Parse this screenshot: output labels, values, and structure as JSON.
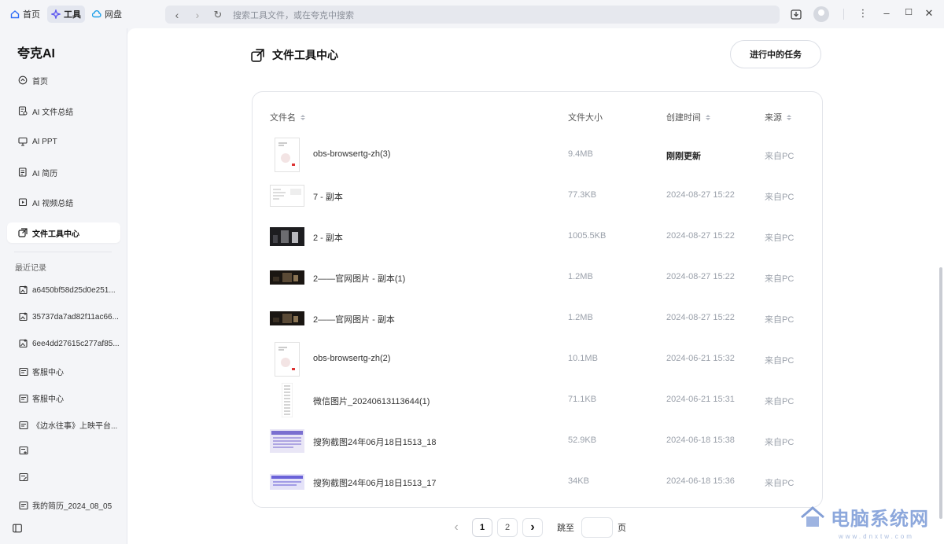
{
  "top": {
    "tabs": [
      {
        "label": "首页",
        "icon": "home-icon"
      },
      {
        "label": "工具",
        "icon": "sparkle-icon",
        "active": true
      },
      {
        "label": "网盘",
        "icon": "cloud-icon"
      }
    ],
    "search_placeholder": "搜索工具文件，或在夸克中搜索"
  },
  "sidebar": {
    "brand": "夸克AI",
    "items": [
      {
        "label": "首页",
        "icon": "home-icon"
      },
      {
        "label": "AI 文件总结",
        "icon": "doc-summary-icon"
      },
      {
        "label": "AI PPT",
        "icon": "presentation-icon"
      },
      {
        "label": "AI 简历",
        "icon": "resume-icon"
      },
      {
        "label": "AI 视频总结",
        "icon": "video-summary-icon"
      },
      {
        "label": "文件工具中心",
        "icon": "file-tools-icon",
        "active": true
      }
    ],
    "recent_title": "最近记录",
    "recent": [
      {
        "label": "a6450bf58d25d0e251...",
        "icon": "image-icon"
      },
      {
        "label": "35737da7ad82f11ac66...",
        "icon": "image-icon"
      },
      {
        "label": "6ee4dd27615c277af85...",
        "icon": "image-icon"
      },
      {
        "label": "客服中心",
        "icon": "doc-icon"
      },
      {
        "label": "客服中心",
        "icon": "doc-icon"
      },
      {
        "label": "《边水往事》上映平台...",
        "icon": "doc-icon"
      },
      {
        "label": "",
        "icon": "doc-add-icon"
      },
      {
        "label": "",
        "icon": "doc-edit-icon"
      },
      {
        "label": "我的简历_2024_08_05",
        "icon": "doc-icon"
      }
    ]
  },
  "main": {
    "title": "文件工具中心",
    "tasks_button": "进行中的任务",
    "columns": {
      "name": "文件名",
      "size": "文件大小",
      "time": "创建时间",
      "source": "来源"
    },
    "files": [
      {
        "name": "obs-browsertg-zh(3)",
        "size": "9.4MB",
        "time": "刚刚更新",
        "source": "来自PC",
        "thumb": "pdf"
      },
      {
        "name": "7 - 副本",
        "size": "77.3KB",
        "time": "2024-08-27 15:22",
        "source": "来自PC",
        "thumb": "page"
      },
      {
        "name": "2 - 副本",
        "size": "1005.5KB",
        "time": "2024-08-27 15:22",
        "source": "来自PC",
        "thumb": "dark"
      },
      {
        "name": "2——官网图片 - 副本(1)",
        "size": "1.2MB",
        "time": "2024-08-27 15:22",
        "source": "来自PC",
        "thumb": "darkwide"
      },
      {
        "name": "2——官网图片 - 副本",
        "size": "1.2MB",
        "time": "2024-08-27 15:22",
        "source": "来自PC",
        "thumb": "darkwide"
      },
      {
        "name": "obs-browsertg-zh(2)",
        "size": "10.1MB",
        "time": "2024-06-21 15:32",
        "source": "来自PC",
        "thumb": "pdf"
      },
      {
        "name": "微信图片_20240613113644(1)",
        "size": "71.1KB",
        "time": "2024-06-21 15:31",
        "source": "来自PC",
        "thumb": "tall"
      },
      {
        "name": "搜狗截图24年06月18日1513_18",
        "size": "52.9KB",
        "time": "2024-06-18 15:38",
        "source": "来自PC",
        "thumb": "screenshot"
      },
      {
        "name": "搜狗截图24年06月18日1513_17",
        "size": "34KB",
        "time": "2024-06-18 15:36",
        "source": "来自PC",
        "thumb": "screenshot2"
      }
    ],
    "pagination": {
      "pages": [
        "1",
        "2"
      ],
      "current": "1",
      "jump_label": "跳至",
      "page_suffix": "页"
    }
  },
  "watermark": {
    "text": "电脑系统网",
    "sub": "www.dnxtw.com"
  }
}
